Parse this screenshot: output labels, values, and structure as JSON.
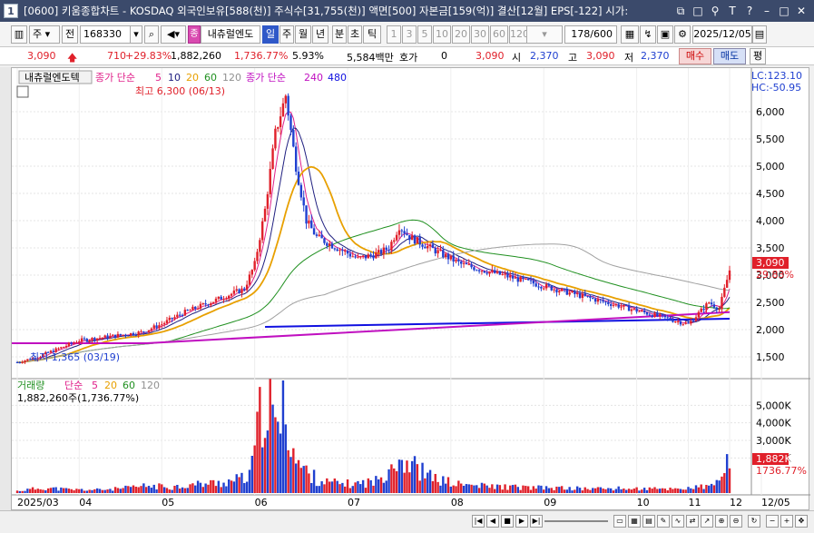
{
  "titlebar": {
    "window_number": "1",
    "title": "[0600] 키움종합차트 - KOSDAQ 외국인보유[588(천)] 주식수[31,755(천)] 액면[500] 자본금[159(억)] 결산[12월] EPS[-122] 시가:"
  },
  "toolbar": {
    "period_ju": "주",
    "prev_label": "전",
    "stock_code": "168330",
    "stock_name": "내츄럴엔도",
    "periods": [
      "일",
      "주",
      "월",
      "년",
      "분",
      "초",
      "틱"
    ],
    "intervals": [
      "1",
      "3",
      "5",
      "10",
      "20",
      "30",
      "60",
      "120"
    ],
    "count": "178/600",
    "date": "2025/12/05",
    "flat_label": "평"
  },
  "quote": {
    "price": "3,090",
    "change": "710",
    "change_pct": "+29.83%",
    "volume": "1,882,260",
    "volume_pct": "1,736.77%",
    "turnover": "5.93%",
    "amount": "5,584백만",
    "hoga_label": "호가",
    "hoga_value": "0",
    "hoga_price": "3,090",
    "open_label": "시",
    "open_value": "2,370",
    "high_label": "고",
    "high_value": "3,090",
    "low_label": "저",
    "low_value": "2,370",
    "buy_label": "매수",
    "sell_label": "매도"
  },
  "chart": {
    "stock_label": "내츄럴엔도텍",
    "ma_prefix": "종가 단순",
    "ma_periods": [
      "5",
      "10",
      "20",
      "60",
      "120"
    ],
    "ma2_prefix": "종가 단순",
    "ma2_periods": [
      "240",
      "480"
    ],
    "lc_label": "LC:123.10",
    "hc_label": "HC:-50.95",
    "max_label": "최고 6,300 (06/13)",
    "min_label": "최저 1,365 (03/19)",
    "price_tag": "3,090",
    "price_tag_pct": "29.83%",
    "price_ticks": [
      "6,000",
      "5,500",
      "5,000",
      "4,500",
      "4,000",
      "3,500",
      "3,000",
      "2,500",
      "2,000",
      "1,500"
    ],
    "volume_title": "거래량",
    "vol_ma_prefix": "단순",
    "vol_ma_periods": [
      "5",
      "20",
      "60",
      "120"
    ],
    "volume_value": "1,882,260주(1,736.77%)",
    "volume_ticks": [
      "5,000K",
      "4,000K",
      "3,000K",
      "2,000K"
    ],
    "volume_tag": "1,882K",
    "volume_tag_pct": "1736.77%",
    "date_labels": [
      "2025/03",
      "04",
      "05",
      "06",
      "07",
      "08",
      "09",
      "10",
      "11",
      "12",
      "12/05"
    ]
  },
  "colors": {
    "up": "#e0202a",
    "down": "#2040d0",
    "ma5": "#e0208a",
    "ma10": "#202080",
    "ma20": "#e8a000",
    "ma60": "#209020",
    "ma120": "#a0a0a0",
    "trend_blue": "#1010e0",
    "trend_magenta": "#c010c0"
  },
  "chart_data": {
    "type": "candlestick",
    "ylim": [
      1300,
      6300
    ],
    "price_path": [
      [
        0,
        1400
      ],
      [
        8,
        1500
      ],
      [
        16,
        1650
      ],
      [
        24,
        1800
      ],
      [
        32,
        1850
      ],
      [
        40,
        1900
      ],
      [
        48,
        1950
      ],
      [
        56,
        2100
      ],
      [
        64,
        2300
      ],
      [
        72,
        2450
      ],
      [
        80,
        2600
      ],
      [
        88,
        2750
      ],
      [
        92,
        3200
      ],
      [
        96,
        4200
      ],
      [
        100,
        5600
      ],
      [
        104,
        6300
      ],
      [
        108,
        5000
      ],
      [
        112,
        4000
      ],
      [
        116,
        3700
      ],
      [
        120,
        3600
      ],
      [
        124,
        3500
      ],
      [
        128,
        3400
      ],
      [
        132,
        3300
      ],
      [
        136,
        3350
      ],
      [
        140,
        3400
      ],
      [
        144,
        3500
      ],
      [
        148,
        3900
      ],
      [
        152,
        3700
      ],
      [
        156,
        3600
      ],
      [
        160,
        3500
      ],
      [
        164,
        3400
      ],
      [
        168,
        3300
      ],
      [
        172,
        3200
      ],
      [
        176,
        3150
      ],
      [
        180,
        3100
      ],
      [
        184,
        3050
      ],
      [
        188,
        3000
      ],
      [
        192,
        2950
      ],
      [
        196,
        2900
      ],
      [
        200,
        2850
      ],
      [
        204,
        2800
      ],
      [
        208,
        2750
      ],
      [
        212,
        2700
      ],
      [
        216,
        2650
      ],
      [
        220,
        2600
      ],
      [
        224,
        2550
      ],
      [
        228,
        2500
      ],
      [
        232,
        2450
      ],
      [
        236,
        2400
      ],
      [
        240,
        2350
      ],
      [
        244,
        2300
      ],
      [
        248,
        2250
      ],
      [
        252,
        2200
      ],
      [
        256,
        2150
      ],
      [
        260,
        2100
      ],
      [
        264,
        2300
      ],
      [
        268,
        2500
      ],
      [
        272,
        2380
      ],
      [
        276,
        3090
      ]
    ],
    "volume_path": [
      [
        0,
        120
      ],
      [
        10,
        300
      ],
      [
        20,
        200
      ],
      [
        30,
        180
      ],
      [
        40,
        250
      ],
      [
        50,
        400
      ],
      [
        60,
        350
      ],
      [
        70,
        500
      ],
      [
        80,
        600
      ],
      [
        90,
        900
      ],
      [
        96,
        5700
      ],
      [
        100,
        3500
      ],
      [
        104,
        4800
      ],
      [
        108,
        1800
      ],
      [
        112,
        1200
      ],
      [
        116,
        800
      ],
      [
        120,
        600
      ],
      [
        130,
        500
      ],
      [
        140,
        700
      ],
      [
        146,
        2000
      ],
      [
        150,
        1900
      ],
      [
        160,
        900
      ],
      [
        170,
        500
      ],
      [
        180,
        400
      ],
      [
        190,
        350
      ],
      [
        200,
        300
      ],
      [
        210,
        280
      ],
      [
        220,
        250
      ],
      [
        230,
        260
      ],
      [
        240,
        240
      ],
      [
        250,
        230
      ],
      [
        260,
        280
      ],
      [
        270,
        400
      ],
      [
        276,
        1882
      ]
    ],
    "volume_unit": "K"
  }
}
